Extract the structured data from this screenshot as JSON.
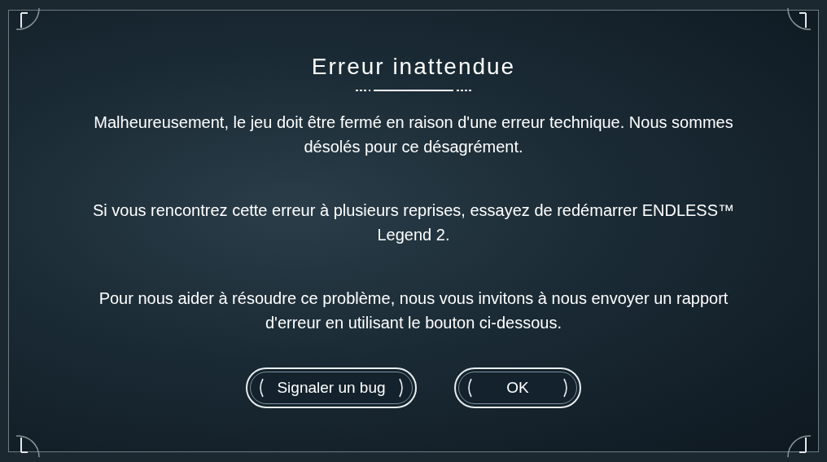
{
  "dialog": {
    "title": "Erreur inattendue",
    "paragraphs": [
      "Malheureusement, le jeu doit être fermé en raison d'une erreur technique. Nous sommes désolés pour ce désagrément.",
      "Si vous rencontrez cette erreur à plusieurs reprises, essayez de redémarrer ENDLESS™ Legend 2.",
      "Pour nous aider à résoudre ce problème, nous vous invitons à nous envoyer un rapport d'erreur en utilisant le bouton ci-dessous."
    ],
    "buttons": [
      {
        "label": "Signaler un bug",
        "kind": "report"
      },
      {
        "label": "OK",
        "kind": "ok"
      }
    ]
  }
}
